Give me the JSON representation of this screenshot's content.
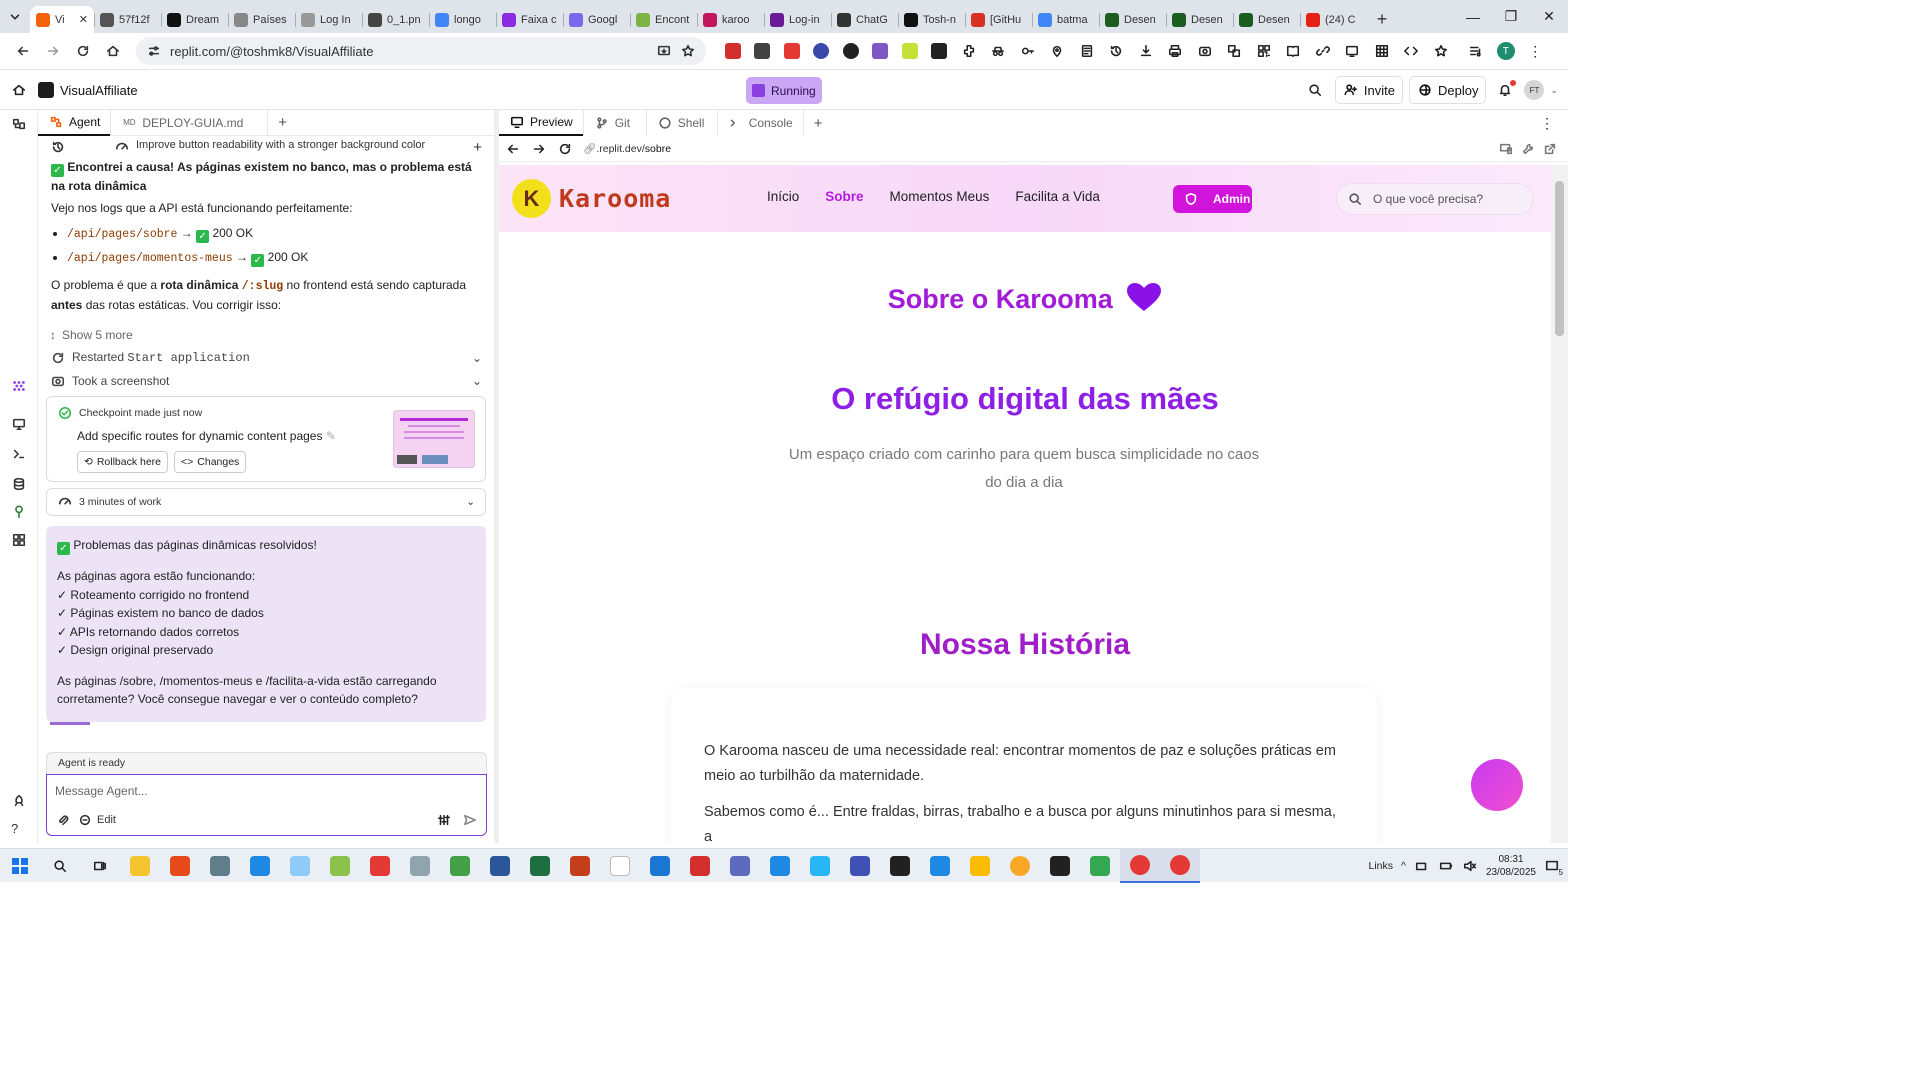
{
  "browser": {
    "tabs": [
      {
        "title": "Vi",
        "favicon_color": "#f26207",
        "active": true
      },
      {
        "title": "57f12f",
        "favicon_color": "#555555"
      },
      {
        "title": "Dream",
        "favicon_color": "#111111"
      },
      {
        "title": "Países",
        "favicon_color": "#888888"
      },
      {
        "title": "Log In",
        "favicon_color": "#999999"
      },
      {
        "title": "0_1.pn",
        "favicon_color": "#444444"
      },
      {
        "title": "longo",
        "favicon_color": "#4285f4"
      },
      {
        "title": "Faixa c",
        "favicon_color": "#8a2be2"
      },
      {
        "title": "Googl",
        "favicon_color": "#7b68ee"
      },
      {
        "title": "Encont",
        "favicon_color": "#7cb342"
      },
      {
        "title": "karoo",
        "favicon_color": "#c2185b"
      },
      {
        "title": "Log-in",
        "favicon_color": "#6a1b9a"
      },
      {
        "title": "ChatG",
        "favicon_color": "#333333"
      },
      {
        "title": "Tosh-n",
        "favicon_color": "#111111"
      },
      {
        "title": "[GitHu",
        "favicon_color": "#d93025"
      },
      {
        "title": "batma",
        "favicon_color": "#4285f4"
      },
      {
        "title": "Desen",
        "favicon_color": "#1b5e20"
      },
      {
        "title": "Desen",
        "favicon_color": "#1b5e20"
      },
      {
        "title": "Desen",
        "favicon_color": "#1b5e20"
      },
      {
        "title": "(24) C",
        "favicon_color": "#e62117"
      }
    ],
    "url": "replit.com/@toshmk8/VisualAffiliate",
    "profile_initial": "T",
    "extension_colors": [
      "#d32f2f",
      "#424242",
      "#e53935",
      "#3949ab",
      "#212121",
      "#7e57c2",
      "#c6e03a",
      "#222222"
    ]
  },
  "replit": {
    "project_name": "VisualAffiliate",
    "run_status": "Running",
    "invite_label": "Invite",
    "deploy_label": "Deploy",
    "user_initials": "FT",
    "left_tabs": [
      "Agent",
      "DEPLOY-GUIA.md"
    ],
    "right_tabs": [
      "Preview",
      "Git",
      "Shell",
      "Console"
    ],
    "history_title": "Improve button readability with a stronger background color",
    "preview_url_prefix": ".replit.dev/",
    "preview_url_path": "sobre"
  },
  "agent": {
    "msg1_title": "Encontrei a causa! As páginas existem no banco, mas o problema está na rota dinâmica",
    "msg1_line": "Vejo nos logs que a API está funcionando perfeitamente:",
    "msg1_items": [
      {
        "path": "/api/pages/sobre",
        "status": "200 OK"
      },
      {
        "path": "/api/pages/momentos-meus",
        "status": "200 OK"
      }
    ],
    "msg1_p_a": "O problema é que a ",
    "msg1_p_b": "rota dinâmica",
    "msg1_p_slug": "/:slug",
    "msg1_p_c": " no frontend está sendo capturada ",
    "msg1_p_d": "antes",
    "msg1_p_e": " das rotas estáticas. Vou corrigir isso:",
    "show_more": "Show 5 more",
    "restarted_prefix": "Restarted ",
    "restarted_code": "Start application",
    "screenshot_label": "Took a screenshot",
    "checkpoint_label": "Checkpoint made just now",
    "checkpoint_desc": "Add specific routes for dynamic content pages",
    "rollback_label": "Rollback here",
    "changes_label": "Changes",
    "work_label": "3 minutes of work",
    "done_title": "Problemas das páginas dinâmicas resolvidos!",
    "done_intro": "As páginas agora estão funcionando:",
    "done_items": [
      "✓ Roteamento corrigido no frontend",
      "✓ Páginas existem no banco de dados",
      "✓ APIs retornando dados corretos",
      "✓ Design original preservado"
    ],
    "done_question": "As páginas /sobre, /momentos-meus e /facilita-a-vida estão carregando corretamente? Você consegue navegar e ver o conteúdo completo?",
    "ready_label": "Agent is ready",
    "input_placeholder": "Message Agent...",
    "edit_label": "Edit"
  },
  "site": {
    "logo_text": "Karooma",
    "logo_letter": "K",
    "nav": [
      "Início",
      "Sobre",
      "Momentos Meus",
      "Facilita a Vida"
    ],
    "active_nav": "Sobre",
    "admin_label": "Admin",
    "search_placeholder": "O que você precisa?",
    "heading_sobre": "Sobre o Karooma",
    "heading_refugio": "O refúgio digital das mães",
    "subtitle": "Um espaço criado com carinho para quem busca simplicidade no caos do dia a dia",
    "heading_historia": "Nossa História",
    "para1": "O Karooma nasceu de uma necessidade real: encontrar momentos de paz e soluções práticas em meio ao turbilhão da maternidade.",
    "para2": "Sabemos como é... Entre fraldas, birras, trabalho e a busca por alguns minutinhos para si mesma, a",
    "accent_color": "#a11bd8",
    "admin_color": "#d014dc"
  },
  "taskbar": {
    "links_label": "Links",
    "time": "08:31",
    "date": "23/08/2025",
    "notif_count": "5",
    "app_colors": [
      "#f4c430",
      "#e64a19",
      "#607d8b",
      "#1e88e5",
      "#90caf9",
      "#8bc34a",
      "#e53935",
      "#90a4ae",
      "#43a047",
      "#2b579a",
      "#1d6f42",
      "#c43e1c",
      "#ffffff",
      "#1976d2",
      "#d32f2f",
      "#5c6bc0",
      "#1e88e5",
      "#29b6f6",
      "#3f51b5",
      "#212121",
      "#1e88e5",
      "#fbbc05",
      "#f9a825",
      "#212121",
      "#34a853",
      "#e53935",
      "#e53935"
    ]
  }
}
